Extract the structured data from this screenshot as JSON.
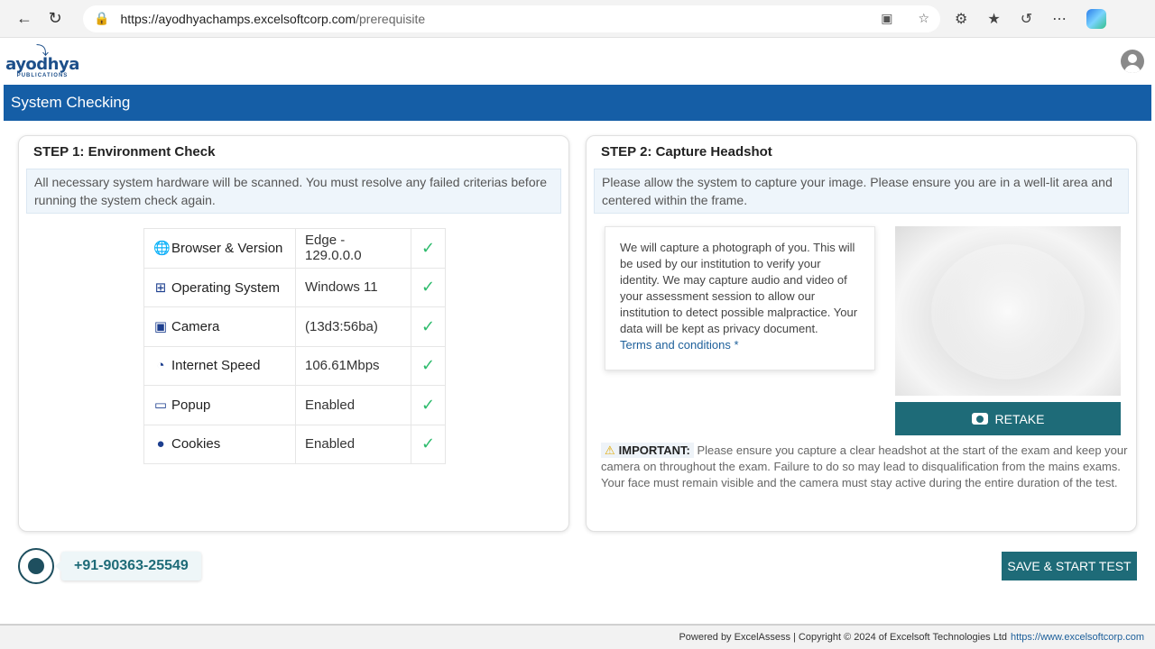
{
  "browser": {
    "url_host": "https://ayodhyachamps.excelsoftcorp.com",
    "url_path": "/prerequisite"
  },
  "header": {
    "logo_brand": "ayodhya",
    "logo_sub": "PUBLICATIONS",
    "title": "System Checking"
  },
  "step1": {
    "title": "STEP 1: Environment Check",
    "info": "All necessary system hardware will be scanned. You must resolve any failed criterias before running the system check again.",
    "rows": [
      {
        "icon": "globe-icon",
        "label": "Browser & Version",
        "value": "Edge - 129.0.0.0",
        "status": "✓"
      },
      {
        "icon": "windows-icon",
        "label": "Operating System",
        "value": "Windows 11",
        "status": "✓"
      },
      {
        "icon": "camera-icon",
        "label": "Camera",
        "value": "(13d3:56ba)",
        "status": "✓"
      },
      {
        "icon": "speedometer-icon",
        "label": "Internet Speed",
        "value": "106.61Mbps",
        "status": "✓"
      },
      {
        "icon": "monitor-icon",
        "label": "Popup",
        "value": "Enabled",
        "status": "✓"
      },
      {
        "icon": "cookie-icon",
        "label": "Cookies",
        "value": "Enabled",
        "status": "✓"
      }
    ]
  },
  "step2": {
    "title": "STEP 2: Capture Headshot",
    "info": "Please allow the system to capture your image. Please ensure you are in a well-lit area and centered within the frame.",
    "consent": "We will capture a photograph of you. This will be used by our institution to verify your identity. We may capture audio and video of your assessment session to allow our institution to detect possible malpractice. Your data will be kept as privacy document.",
    "terms": "Terms and conditions *",
    "retake_label": "RETAKE",
    "important_tag": "IMPORTANT:",
    "important_text": "Please ensure you capture a clear headshot at the start of the exam and keep your camera on throughout the exam. Failure to do so may lead to disqualification from the mains exams. Your face must remain visible and the camera must stay active during the entire duration of the test."
  },
  "support": {
    "phone": "+91-90363-25549"
  },
  "actions": {
    "start_label": "SAVE & START TEST"
  },
  "footer": {
    "text": "Powered by ExcelAssess | Copyright © 2024 of Excelsoft Technologies Ltd",
    "link": "https://www.excelsoftcorp.com"
  },
  "colors": {
    "title_bar": "#155ea6",
    "teal_button": "#1e6b78",
    "check_green": "#2dbb6c"
  }
}
